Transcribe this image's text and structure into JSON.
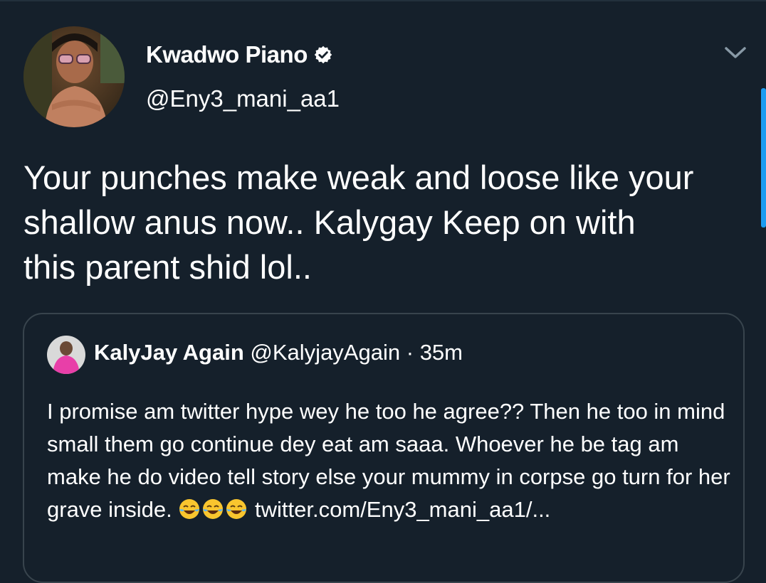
{
  "tweet": {
    "author": {
      "display_name": "Kwadwo Piano",
      "handle": "@Eny3_mani_aa1",
      "verified": true
    },
    "text": "Your punches make weak and loose like your\nshallow anus now..  Kalygay Keep on with\nthis parent shid lol..",
    "menu_icon": "chevron-down-icon"
  },
  "quote": {
    "display_name": "KalyJay Again",
    "handle": "@KalyjayAgain",
    "separator": "·",
    "time": "35m",
    "text": "I promise am twitter hype wey he too he agree?? Then he too in mind small them go continue dey eat am saaa. Whoever he be tag am make he do video tell story else your mummy in corpse go turn for her grave inside.",
    "emojis": [
      "face-with-tears-of-joy",
      "face-with-tears-of-joy",
      "face-with-tears-of-joy"
    ],
    "link": "twitter.com/Eny3_mani_aa1/..."
  },
  "colors": {
    "background": "#15202b",
    "border": "#38444d",
    "text": "#ffffff",
    "muted": "#8899a6",
    "accent": "#1d9bf0"
  }
}
